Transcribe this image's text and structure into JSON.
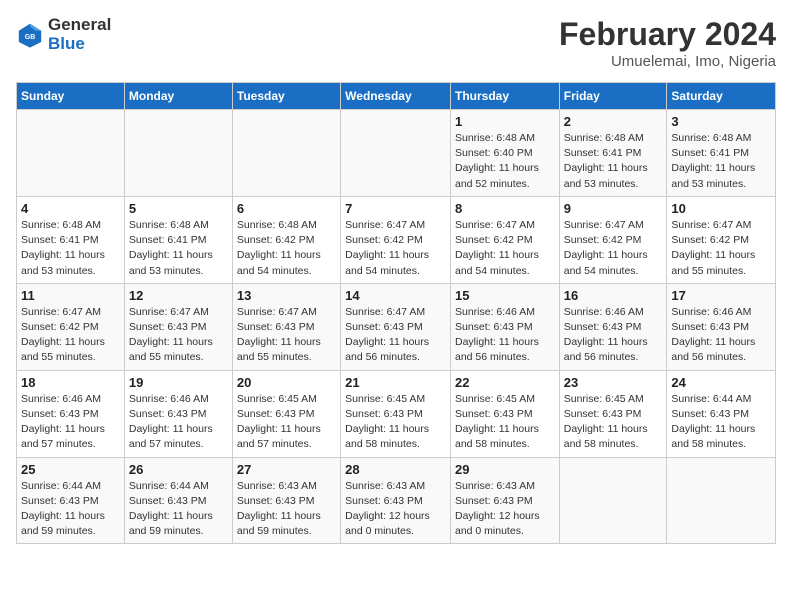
{
  "logo": {
    "line1": "General",
    "line2": "Blue"
  },
  "title": {
    "month_year": "February 2024",
    "location": "Umuelemai, Imo, Nigeria"
  },
  "days_of_week": [
    "Sunday",
    "Monday",
    "Tuesday",
    "Wednesday",
    "Thursday",
    "Friday",
    "Saturday"
  ],
  "weeks": [
    [
      {
        "day": "",
        "info": ""
      },
      {
        "day": "",
        "info": ""
      },
      {
        "day": "",
        "info": ""
      },
      {
        "day": "",
        "info": ""
      },
      {
        "day": "1",
        "info": "Sunrise: 6:48 AM\nSunset: 6:40 PM\nDaylight: 11 hours\nand 52 minutes."
      },
      {
        "day": "2",
        "info": "Sunrise: 6:48 AM\nSunset: 6:41 PM\nDaylight: 11 hours\nand 53 minutes."
      },
      {
        "day": "3",
        "info": "Sunrise: 6:48 AM\nSunset: 6:41 PM\nDaylight: 11 hours\nand 53 minutes."
      }
    ],
    [
      {
        "day": "4",
        "info": "Sunrise: 6:48 AM\nSunset: 6:41 PM\nDaylight: 11 hours\nand 53 minutes."
      },
      {
        "day": "5",
        "info": "Sunrise: 6:48 AM\nSunset: 6:41 PM\nDaylight: 11 hours\nand 53 minutes."
      },
      {
        "day": "6",
        "info": "Sunrise: 6:48 AM\nSunset: 6:42 PM\nDaylight: 11 hours\nand 54 minutes."
      },
      {
        "day": "7",
        "info": "Sunrise: 6:47 AM\nSunset: 6:42 PM\nDaylight: 11 hours\nand 54 minutes."
      },
      {
        "day": "8",
        "info": "Sunrise: 6:47 AM\nSunset: 6:42 PM\nDaylight: 11 hours\nand 54 minutes."
      },
      {
        "day": "9",
        "info": "Sunrise: 6:47 AM\nSunset: 6:42 PM\nDaylight: 11 hours\nand 54 minutes."
      },
      {
        "day": "10",
        "info": "Sunrise: 6:47 AM\nSunset: 6:42 PM\nDaylight: 11 hours\nand 55 minutes."
      }
    ],
    [
      {
        "day": "11",
        "info": "Sunrise: 6:47 AM\nSunset: 6:42 PM\nDaylight: 11 hours\nand 55 minutes."
      },
      {
        "day": "12",
        "info": "Sunrise: 6:47 AM\nSunset: 6:43 PM\nDaylight: 11 hours\nand 55 minutes."
      },
      {
        "day": "13",
        "info": "Sunrise: 6:47 AM\nSunset: 6:43 PM\nDaylight: 11 hours\nand 55 minutes."
      },
      {
        "day": "14",
        "info": "Sunrise: 6:47 AM\nSunset: 6:43 PM\nDaylight: 11 hours\nand 56 minutes."
      },
      {
        "day": "15",
        "info": "Sunrise: 6:46 AM\nSunset: 6:43 PM\nDaylight: 11 hours\nand 56 minutes."
      },
      {
        "day": "16",
        "info": "Sunrise: 6:46 AM\nSunset: 6:43 PM\nDaylight: 11 hours\nand 56 minutes."
      },
      {
        "day": "17",
        "info": "Sunrise: 6:46 AM\nSunset: 6:43 PM\nDaylight: 11 hours\nand 56 minutes."
      }
    ],
    [
      {
        "day": "18",
        "info": "Sunrise: 6:46 AM\nSunset: 6:43 PM\nDaylight: 11 hours\nand 57 minutes."
      },
      {
        "day": "19",
        "info": "Sunrise: 6:46 AM\nSunset: 6:43 PM\nDaylight: 11 hours\nand 57 minutes."
      },
      {
        "day": "20",
        "info": "Sunrise: 6:45 AM\nSunset: 6:43 PM\nDaylight: 11 hours\nand 57 minutes."
      },
      {
        "day": "21",
        "info": "Sunrise: 6:45 AM\nSunset: 6:43 PM\nDaylight: 11 hours\nand 58 minutes."
      },
      {
        "day": "22",
        "info": "Sunrise: 6:45 AM\nSunset: 6:43 PM\nDaylight: 11 hours\nand 58 minutes."
      },
      {
        "day": "23",
        "info": "Sunrise: 6:45 AM\nSunset: 6:43 PM\nDaylight: 11 hours\nand 58 minutes."
      },
      {
        "day": "24",
        "info": "Sunrise: 6:44 AM\nSunset: 6:43 PM\nDaylight: 11 hours\nand 58 minutes."
      }
    ],
    [
      {
        "day": "25",
        "info": "Sunrise: 6:44 AM\nSunset: 6:43 PM\nDaylight: 11 hours\nand 59 minutes."
      },
      {
        "day": "26",
        "info": "Sunrise: 6:44 AM\nSunset: 6:43 PM\nDaylight: 11 hours\nand 59 minutes."
      },
      {
        "day": "27",
        "info": "Sunrise: 6:43 AM\nSunset: 6:43 PM\nDaylight: 11 hours\nand 59 minutes."
      },
      {
        "day": "28",
        "info": "Sunrise: 6:43 AM\nSunset: 6:43 PM\nDaylight: 12 hours\nand 0 minutes."
      },
      {
        "day": "29",
        "info": "Sunrise: 6:43 AM\nSunset: 6:43 PM\nDaylight: 12 hours\nand 0 minutes."
      },
      {
        "day": "",
        "info": ""
      },
      {
        "day": "",
        "info": ""
      }
    ]
  ]
}
